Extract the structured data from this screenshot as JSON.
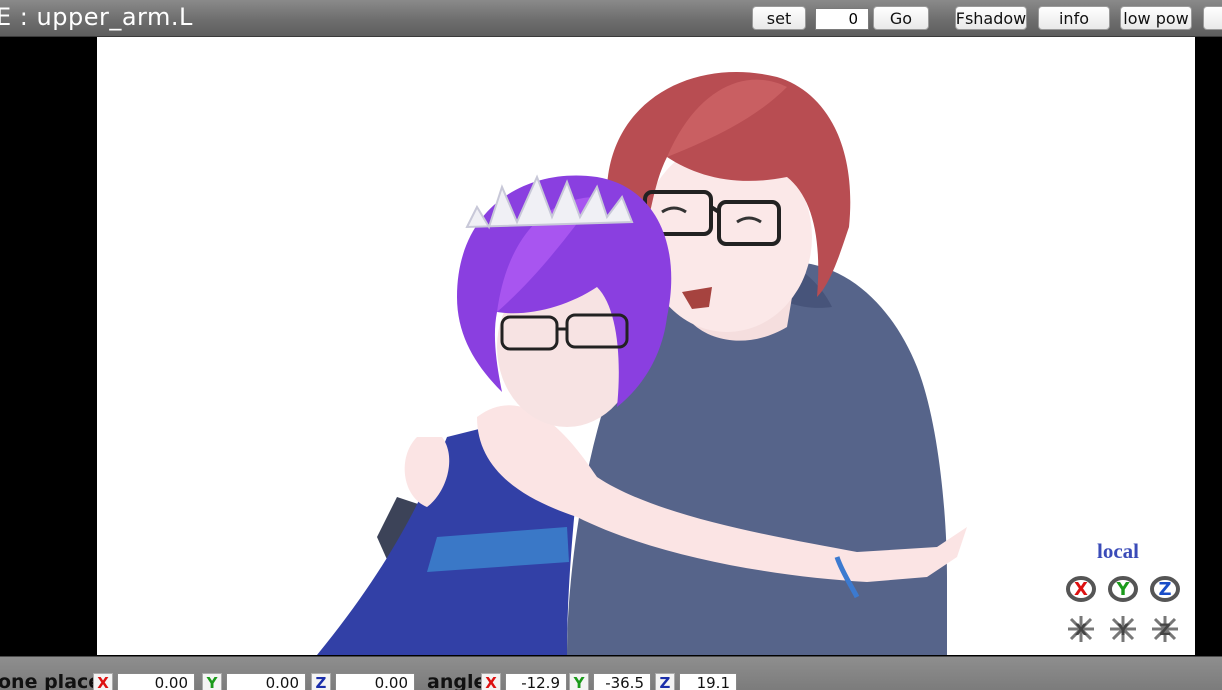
{
  "header": {
    "bone_title": "E : upper_arm.L",
    "set_label": "set",
    "frame_value": "0",
    "go_label": "Go",
    "fshadow_label": "Fshadow",
    "info_label": "info",
    "low_pow_label": "low pow"
  },
  "viewport": {
    "local_label": "local",
    "gizmo_icons": [
      "rotate-x-icon",
      "rotate-y-icon",
      "rotate-z-icon",
      "move-x-icon",
      "move-y-icon",
      "move-z-icon"
    ]
  },
  "footer": {
    "bone_place_label": "one place",
    "place": {
      "x": "0.00",
      "y": "0.00",
      "z": "0.00"
    },
    "angle_label": "angle",
    "angle": {
      "x": "-12.9",
      "y": "-36.5",
      "z": "19.1"
    },
    "axis_x": "X",
    "axis_y": "Y",
    "axis_z": "Z"
  },
  "colors": {
    "axis_x": "#d11111",
    "axis_y": "#1a9a1a",
    "axis_z": "#1a2eaa",
    "local_label": "#3a4bb8"
  }
}
